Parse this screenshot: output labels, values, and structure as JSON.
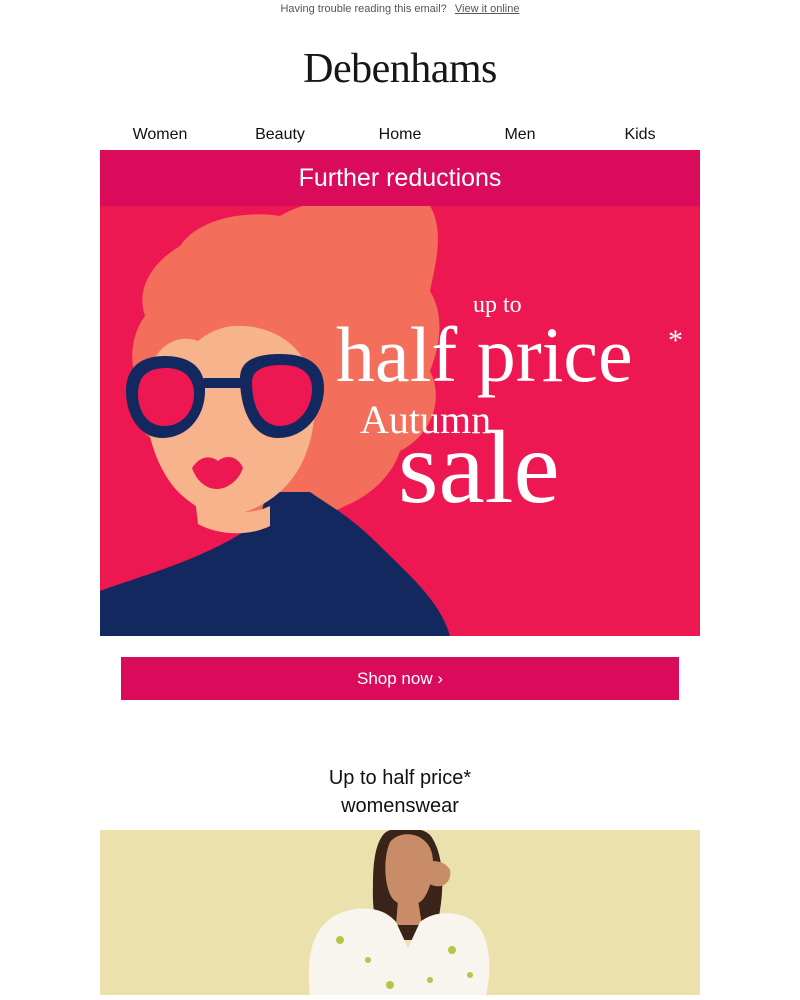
{
  "preheader": {
    "text": "Having trouble reading this email?",
    "link": "View it online"
  },
  "brand": {
    "name": "Debenhams"
  },
  "nav": {
    "items": [
      "Women",
      "Beauty",
      "Home",
      "Men",
      "Kids"
    ]
  },
  "banner": {
    "heading": "Further reductions"
  },
  "hero": {
    "up_to": "up to",
    "half_price": "half price",
    "asterisk": "*",
    "autumn": "Autumn",
    "sale": "sale"
  },
  "cta": {
    "label": "Shop now ›"
  },
  "section": {
    "title_line1": "Up to half price*",
    "title_line2": "womenswear"
  },
  "colors": {
    "accent": "#d90b5a",
    "hero_bg": "#ed1751",
    "hair": "#f36f5b",
    "navy": "#12285e",
    "skin": "#f7b38b",
    "product_bg": "#ebe1ac"
  }
}
